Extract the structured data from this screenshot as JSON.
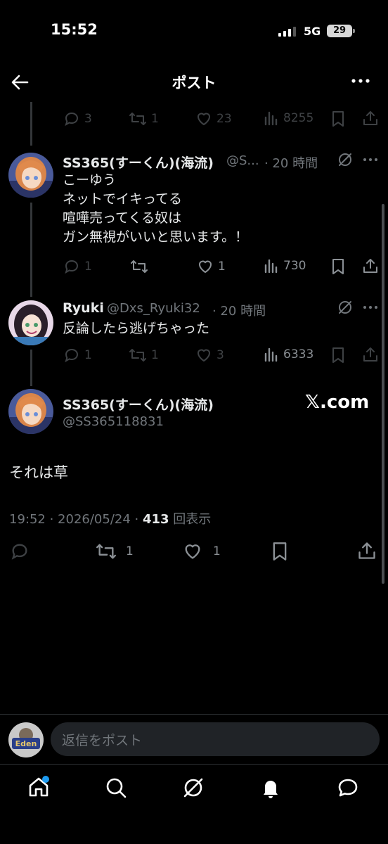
{
  "status": {
    "time": "15:52",
    "network": "5G",
    "battery": "29"
  },
  "header": {
    "title": "ポスト"
  },
  "top_stats": {
    "replies": "3",
    "reposts": "1",
    "likes": "23",
    "views": "8255"
  },
  "tweet1": {
    "name": "SS365(すーくん)(海流)",
    "handle": "@S...",
    "time": "· 20 時間",
    "lines": [
      "こーゆう",
      "ネットでイキってる",
      "喧嘩売ってくる奴は",
      "ガン無視がいいと思います。！"
    ],
    "replies": "1",
    "reposts": "",
    "likes": "1",
    "views": "730"
  },
  "tweet2": {
    "name": "Ryuki",
    "handle": "@Dxs_Ryuki32",
    "time": "· 20 時間",
    "text": "反論したら逃げちゃった",
    "replies": "1",
    "reposts": "1",
    "likes": "3",
    "views": "6333"
  },
  "main": {
    "name": "SS365(すーくん)(海流)",
    "handle": "@SS365118831",
    "watermark": "𝕏.com",
    "text": "それは草",
    "timestamp": "19:52 · 2026/05/24 · ",
    "views_count": "413",
    "views_label": " 回表示",
    "reposts": "1",
    "likes": "1"
  },
  "reply": {
    "placeholder": "返信をポスト",
    "avatar_text": "Eden"
  },
  "colors": {
    "bg": "#000000",
    "text": "#e7e9ea",
    "muted": "#71767b",
    "accent": "#1d9bf0"
  }
}
